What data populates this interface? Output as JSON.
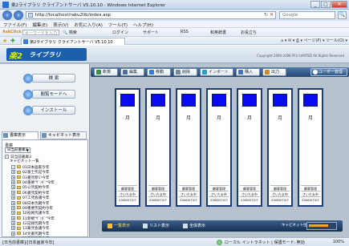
{
  "window": {
    "title": "楽2ライブラリ クライアントサーバ V5.10.10 - Windows Internet Explorer",
    "minimize": "_",
    "maximize": "□",
    "close": "✕"
  },
  "address": {
    "url": "http://localhost/raku2lib/index.asp",
    "refresh_icon": "↻",
    "stop_icon": "✕",
    "search_placeholder": "Google",
    "search_icon": "🔍"
  },
  "menu": {
    "items": [
      "ファイル(F)",
      "編集(E)",
      "表示(V)",
      "お気に入り(A)",
      "ツール(T)",
      "ヘルプ(H)"
    ]
  },
  "toolbar_top": {
    "brand": "AskClick",
    "input_placeholder": "キーワードを入力",
    "search": "🔍 検索",
    "login": "ログイン",
    "support": "サポート",
    "rss": "RSS",
    "dictionary": "和英辞書",
    "sites": "お役立ち"
  },
  "favorites": {
    "tab_title": "楽2ライブラリ クライアントサーバ V5.10.10",
    "commands": "⌂ ▾  ✉ ▾  ⎙ ▾  ページ(P) ▾  ツール(O) ▾"
  },
  "app": {
    "logo_mark": "楽2",
    "logo_name": "ライブラリ",
    "copyright": "Copyright 2000-2008 PFU LIMITED All Rights Reserved"
  },
  "sidebar": {
    "buttons": [
      "検 索",
      "閲覧モードへ",
      "インストール"
    ],
    "tabs": [
      "書庫表示",
      "キャビネット表示"
    ],
    "library_label": "書庫",
    "library_select": "日当前書庫3",
    "tree": [
      {
        "pm": "-",
        "label": "日当前書庫3",
        "folder": false
      },
      {
        "pm": "",
        "label": "キャビネット一覧",
        "folder": false
      },
      {
        "pm": "-",
        "label": "01日本画家今年",
        "folder": true
      },
      {
        "pm": "+",
        "label": "02富士弐記今年",
        "folder": true
      },
      {
        "pm": "+",
        "label": "03書弐新い今年",
        "folder": true
      },
      {
        "pm": "+",
        "label": "04重要\"ｻﾞﾝﾀﾞ\"今年",
        "folder": true
      },
      {
        "pm": "+",
        "label": "05公弐契約今年",
        "folder": true
      },
      {
        "pm": "+",
        "label": "06書弐契約今年",
        "folder": true
      },
      {
        "pm": "+",
        "label": "07工弐会議今年",
        "folder": true
      },
      {
        "pm": "+",
        "label": "08日本弐期今年",
        "folder": true
      },
      {
        "pm": "+",
        "label": "09重要弐契約今年",
        "folder": true
      },
      {
        "pm": "+",
        "label": "10役員弐議今年",
        "folder": true
      },
      {
        "pm": "+",
        "label": "11新規\"ｻﾞﾝﾀﾞ\"今年",
        "folder": true
      },
      {
        "pm": "+",
        "label": "12記録弐期今年",
        "folder": true
      },
      {
        "pm": "+",
        "label": "13業弐会議今年",
        "folder": true
      },
      {
        "pm": "+",
        "label": "14文書弐期今年",
        "folder": true
      },
      {
        "pm": "+",
        "label": "15書類弐期今年",
        "folder": true
      }
    ]
  },
  "main_toolbar": {
    "buttons": [
      "新規",
      "編集",
      "移動",
      "削除",
      "インポート",
      "購入",
      "出力"
    ],
    "user": "ユーザー管理"
  },
  "cards": [
    {
      "glyph": "月",
      "line1": "顧客管理",
      "line2": "さいたま市",
      "line3": "2006/07/07"
    },
    {
      "glyph": "月",
      "line1": "顧客管理",
      "line2": "さいたま市",
      "line3": "2006/07/07"
    },
    {
      "glyph": "月",
      "line1": "顧客管理",
      "line2": "さいたま市",
      "line3": "2006/07/07"
    },
    {
      "glyph": "月",
      "line1": "顧客管理",
      "line2": "さいたま市",
      "line3": "2006/07/07"
    },
    {
      "glyph": "月",
      "line1": "顧客管理",
      "line2": "さいたま市",
      "line3": "2006/07/07"
    },
    {
      "glyph": "月",
      "line1": "顧客管理",
      "line2": "さいたま市",
      "line3": "2006/07/07"
    },
    {
      "glyph": "月",
      "line1": "顧客管理",
      "line2": "さいたま市",
      "line3": "2006/07/07"
    }
  ],
  "view_tabs": [
    "一覧表示",
    "リスト表示",
    "全体表示"
  ],
  "cabinet_position_label": "キャビネット位置",
  "status": {
    "left": "[日当前書庫]/[日本画家今年]",
    "zone": "ローカル イントラネット | 保護モード: 無効",
    "zoom": "100%"
  },
  "colors": {
    "accent": "#1c5faa",
    "toolbar_dark": "#22466f",
    "card_swatch": "#0a0af0",
    "content_bg": "#b7c2cf"
  }
}
